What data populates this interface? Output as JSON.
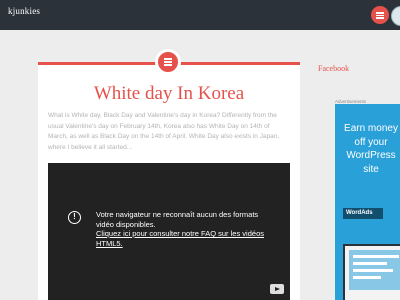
{
  "header": {
    "site_title": "kjunkies",
    "menu_icon": "menu-icon",
    "avatar_icon": "user-avatar"
  },
  "post": {
    "format_icon": "standard-post-format-icon",
    "title": "White day In Korea",
    "excerpt": "What is White day, Black Day and Valentine's day in Korea? Differently from the usual Valentine's day on February 14th, Korea also has White Day on 14th of March, as well as Black Day on the 14th of April. White Day also exists in Japan, where I believe it all started...",
    "video": {
      "message": "Votre navigateur ne reconnaît aucun des formats vidéo disponibles.",
      "link_text": "Cliquez ici pour consulter notre FAQ sur les vidéos HTML5.",
      "warning_icon": "exclamation-icon",
      "brand_icon": "youtube-icon"
    }
  },
  "sidebar": {
    "facebook_heading": "Facebook",
    "ad_label": "Advertisements",
    "ad": {
      "headline": "Earn money off your WordPress site",
      "brand": "WordAds"
    }
  },
  "colors": {
    "accent": "#e5514b",
    "header_bg": "#2b323a",
    "ad_bg": "#2aa0d8"
  }
}
